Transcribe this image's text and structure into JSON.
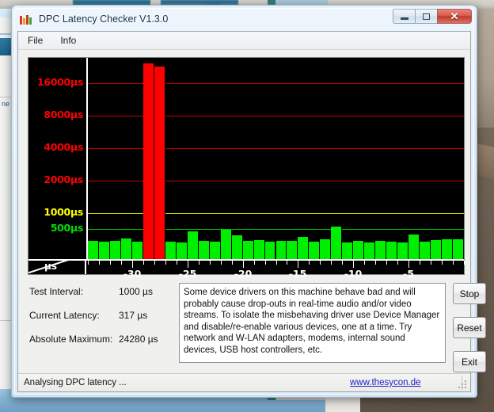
{
  "window": {
    "title": "DPC Latency Checker V1.3.0",
    "icon": "bar-chart-icon",
    "controls": {
      "minimize": "minimize-icon",
      "maximize": "maximize-icon",
      "close": "✕"
    }
  },
  "menu": {
    "items": [
      {
        "label": "File"
      },
      {
        "label": "Info"
      }
    ]
  },
  "stats": {
    "rows": [
      {
        "label": "Test Interval:",
        "value": "1000 µs"
      },
      {
        "label": "Current Latency:",
        "value": "317 µs"
      },
      {
        "label": "Absolute Maximum:",
        "value": "24280 µs"
      }
    ]
  },
  "info_box": {
    "text": "Some device drivers on this machine behave bad and will probably cause drop-outs in real-time audio and/or video streams. To isolate the misbehaving driver use Device Manager and disable/re-enable various devices, one at a time. Try network and W-LAN adapters, modems, internal sound devices, USB host controllers, etc."
  },
  "buttons": [
    {
      "label": "Stop",
      "name": "stop-button"
    },
    {
      "label": "Reset",
      "name": "reset-button"
    },
    {
      "label": "Exit",
      "name": "exit-button"
    }
  ],
  "status_bar": {
    "text": "Analysing DPC latency ...",
    "link": "www.thesycon.de"
  },
  "desktop": {
    "left_panel_text": "ne"
  },
  "chart_data": {
    "type": "bar",
    "title": "",
    "xlabel": "s",
    "ylabel": "µs",
    "corner_labels": {
      "top": "µs",
      "bottom": "s"
    },
    "yscale": "log",
    "ylim": [
      0,
      24000
    ],
    "ytick_values": [
      500,
      1000,
      2000,
      4000,
      8000,
      16000
    ],
    "ytick_labels": [
      "500µs",
      "1000µs",
      "2000µs",
      "4000µs",
      "8000µs",
      "16000µs"
    ],
    "ytick_colors": [
      "#00e000",
      "#ffff00",
      "#ff0000",
      "#ff0000",
      "#ff0000",
      "#ff0000"
    ],
    "gridline_colors": [
      "#00c000",
      "#d0d000",
      "#c00000",
      "#c00000",
      "#c00000",
      "#c00000"
    ],
    "xtick_labels": [
      "-30",
      "-25",
      "-20",
      "-15",
      "-10",
      "-5"
    ],
    "xtick_values": [
      -30,
      -25,
      -20,
      -15,
      -10,
      -5
    ],
    "xlim": [
      -34,
      0
    ],
    "grid": true,
    "legend": "none",
    "bar_colors": {
      "normal": "#00ee00",
      "alarm": "#ff0000"
    },
    "threshold_us": 1000,
    "categories": [
      -33.5,
      -32.5,
      -31.5,
      -30.5,
      -29.5,
      -28.5,
      -27.5,
      -26.5,
      -25.5,
      -24.5,
      -23.5,
      -22.5,
      -21.5,
      -20.5,
      -19.5,
      -18.5,
      -17.5,
      -16.5,
      -15.5,
      -14.5,
      -13.5,
      -12.5,
      -11.5,
      -10.5,
      -9.5,
      -8.5,
      -7.5,
      -6.5,
      -5.5,
      -4.5,
      -3.5,
      -2.5,
      -1.5,
      -0.5
    ],
    "values": [
      300,
      290,
      300,
      340,
      285,
      24280,
      22800,
      295,
      280,
      460,
      300,
      295,
      490,
      390,
      300,
      315,
      285,
      300,
      305,
      375,
      290,
      325,
      560,
      275,
      300,
      280,
      305,
      290,
      280,
      405,
      295,
      320,
      330,
      335
    ]
  }
}
